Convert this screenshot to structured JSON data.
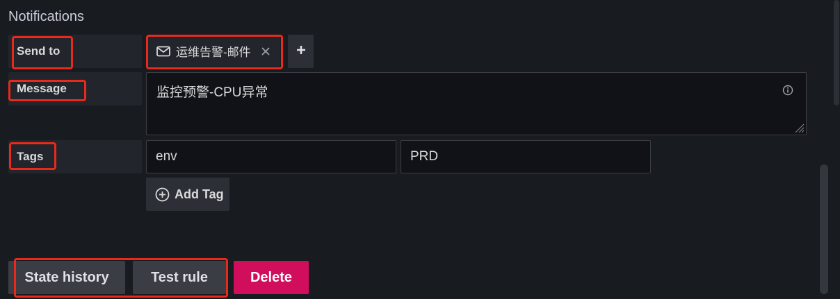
{
  "section": {
    "title": "Notifications"
  },
  "send_to": {
    "label": "Send to",
    "chip": {
      "icon": "mail-icon",
      "text": "运维告警-邮件",
      "remove_icon": "close-icon"
    },
    "add_icon": "plus-icon"
  },
  "message": {
    "label": "Message",
    "value": "监控预警-CPU异常",
    "info_icon": "info-icon",
    "resize_icon": "resize-handle-icon"
  },
  "tags": {
    "label": "Tags",
    "key_value": "env",
    "value_value": "PRD",
    "add_tag_label": "Add Tag",
    "add_tag_icon": "plus-circle-icon"
  },
  "footer": {
    "state_history_label": "State history",
    "test_rule_label": "Test rule",
    "delete_label": "Delete"
  },
  "colors": {
    "background": "#181b1f",
    "highlight": "#e8291b",
    "danger": "#d10e5c"
  }
}
